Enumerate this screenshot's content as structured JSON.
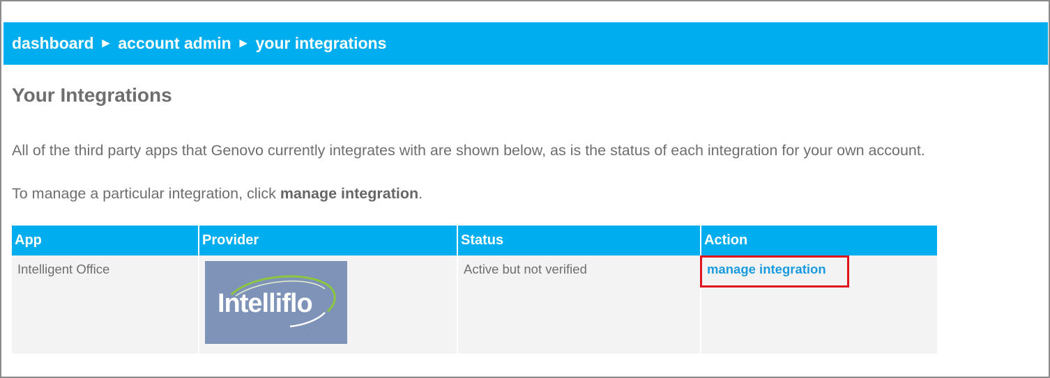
{
  "breadcrumb": {
    "items": [
      {
        "label": "dashboard"
      },
      {
        "label": "account admin"
      },
      {
        "label": "your integrations"
      }
    ],
    "separator": "►"
  },
  "page": {
    "title": "Your Integrations",
    "intro": "All of the third party apps that Genovo currently integrates with are shown below, as is the status of each integration for your own account.",
    "instruction_prefix": "To manage a particular integration, click ",
    "instruction_bold": "manage integration",
    "instruction_suffix": "."
  },
  "table": {
    "headers": {
      "app": "App",
      "provider": "Provider",
      "status": "Status",
      "action": "Action"
    },
    "rows": [
      {
        "app": "Intelligent Office",
        "provider_logo_text": "Intelliflo",
        "status": "Active but not verified",
        "action": "manage integration"
      }
    ]
  },
  "colors": {
    "brand_blue": "#00aeef",
    "link_blue": "#1a9be0",
    "highlight_red": "#e0141c",
    "logo_bg": "#7f93b8"
  },
  "icons": {
    "breadcrumb_separator": "triangle-right-icon",
    "provider_logo": "intelliflo-logo"
  }
}
